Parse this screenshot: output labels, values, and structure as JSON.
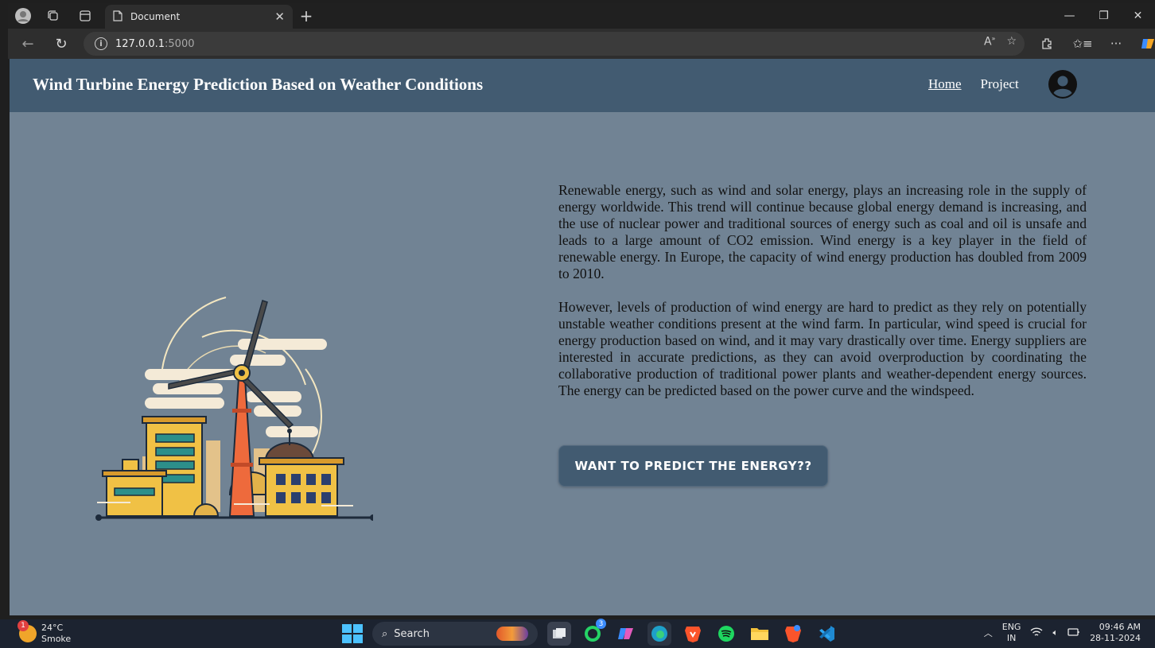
{
  "browser": {
    "tab_title": "Document",
    "url_host": "127.0.0.1",
    "url_port": ":5000",
    "icons": [
      "profile-icon",
      "workspaces-icon",
      "tab-actions-icon",
      "document-icon",
      "close-icon",
      "new-tab-icon",
      "minimize-icon",
      "restore-icon",
      "back-icon",
      "refresh-icon",
      "info-icon",
      "read-aloud-icon",
      "favorite-star-icon",
      "extensions-icon",
      "favorites-icon",
      "more-icon",
      "copilot-icon"
    ]
  },
  "site": {
    "title": "Wind Turbine Energy Prediction Based on Weather Conditions",
    "nav": [
      {
        "label": "Home",
        "active": true
      },
      {
        "label": "Project",
        "active": false
      }
    ]
  },
  "main": {
    "paragraphs": [
      "Renewable energy, such as wind and solar energy, plays an increasing role in the supply of energy worldwide. This trend will continue because global energy demand is increasing, and the use of nuclear power and traditional sources of energy such as coal and oil is unsafe and leads to a large amount of CO2 emission. Wind energy is a key player in the field of renewable energy. In Europe, the capacity of wind energy production has doubled from 2009 to 2010.",
      "However, levels of production of wind energy are hard to predict as they rely on potentially unstable weather conditions present at the wind farm. In particular, wind speed is crucial for energy production based on wind, and it may vary drastically over time. Energy suppliers are interested in accurate predictions, as they can avoid overproduction by coordinating the collaborative production of traditional power plants and weather-dependent energy sources. The energy can be predicted based on the power curve and the windspeed."
    ],
    "cta_label": "WANT TO PREDICT THE ENERGY??"
  },
  "taskbar": {
    "weather_temp": "24°C",
    "weather_desc": "Smoke",
    "weather_badge": "1",
    "search_label": "Search",
    "whatsapp_badge": "3",
    "lang_top": "ENG",
    "lang_bottom": "IN",
    "time": "09:46 AM",
    "date": "28-11-2024"
  },
  "colors": {
    "header_bg": "#425b71",
    "page_bg": "#718394",
    "cta_bg": "#425b71"
  }
}
